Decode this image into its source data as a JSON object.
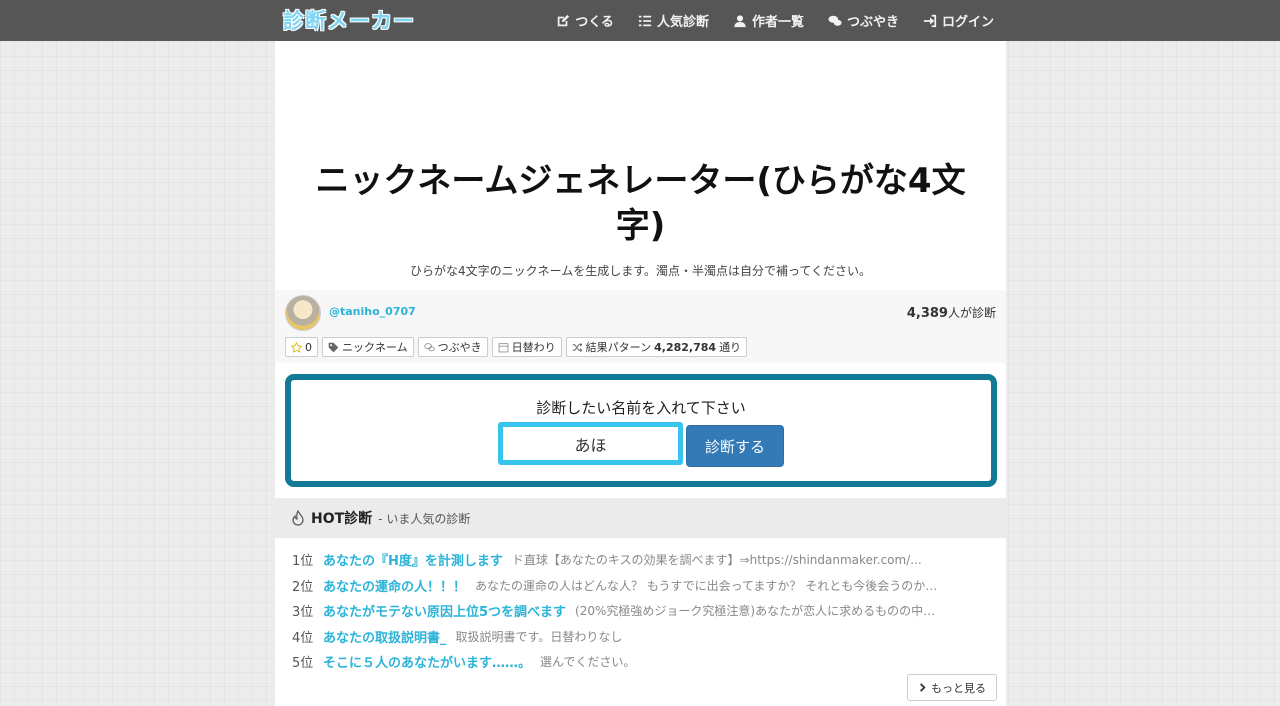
{
  "nav": {
    "logo": "診断メーカー",
    "items": [
      {
        "label": "つくる",
        "icon": "edit-icon"
      },
      {
        "label": "人気診断",
        "icon": "list-icon"
      },
      {
        "label": "作者一覧",
        "icon": "user-icon"
      },
      {
        "label": "つぶやき",
        "icon": "comments-icon"
      },
      {
        "label": "ログイン",
        "icon": "login-icon"
      }
    ]
  },
  "page": {
    "title": "ニックネームジェネレーター(ひらがな4文字)",
    "description": "ひらがな4文字のニックネームを生成します。濁点・半濁点は自分で補ってください。"
  },
  "meta": {
    "author": "@taniho_0707",
    "count_number": "4,389",
    "count_suffix": "人が診断",
    "favorites": "0",
    "tag_label": "ニックネーム",
    "tweet_label": "つぶやき",
    "daily_label": "日替わり",
    "patterns_label": "結果パターン",
    "patterns_value": "4,282,784",
    "patterns_unit": "通り"
  },
  "form": {
    "label": "診断したい名前を入れて下さい",
    "input_value": "あほ",
    "submit_label": "診断する"
  },
  "hot": {
    "title": "HOT診断",
    "subtitle": " - いま人気の診断",
    "items": [
      {
        "rank": "1位",
        "title": "あなたの『H度』を計測します",
        "desc": "ド直球【あなたのキスの効果を調べます】⇒https://shindanmaker.com/..."
      },
      {
        "rank": "2位",
        "title": "あなたの運命の人！！！",
        "desc": "あなたの運命の人はどんな人？ もうすでに出会ってますか？ それとも今後会うのか…"
      },
      {
        "rank": "3位",
        "title": "あなたがモテない原因上位5つを調べます",
        "desc": "(20%究極強めジョーク究極注意)あなたが恋人に求めるものの中…"
      },
      {
        "rank": "4位",
        "title": "あなたの取扱説明書_",
        "desc": "取扱説明書です。日替わりなし"
      },
      {
        "rank": "5位",
        "title": "そこに５人のあなたがいます……。",
        "desc": "選んでください。"
      }
    ],
    "more_label": "もっと見る"
  },
  "colors": {
    "accent": "#2bb3d8",
    "form_border": "#137a96",
    "input_border": "#37c5ee",
    "button": "#337ab7",
    "navbar": "#565656"
  }
}
